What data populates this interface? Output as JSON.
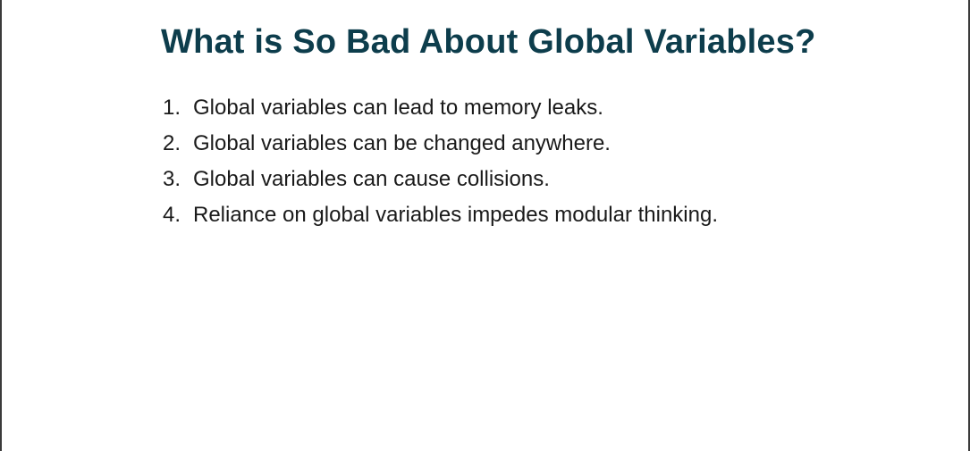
{
  "slide": {
    "title": "What is So Bad About Global Variables?",
    "points": [
      {
        "number": "1.",
        "text": "Global variables can lead to memory leaks."
      },
      {
        "number": "2.",
        "text": "Global variables can be changed anywhere."
      },
      {
        "number": "3.",
        "text": "Global variables can cause collisions."
      },
      {
        "number": "4.",
        "text": "Reliance on global variables impedes modular thinking."
      }
    ]
  }
}
